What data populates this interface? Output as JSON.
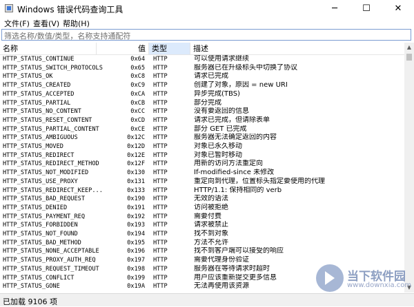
{
  "window": {
    "title": "Windows 错误代码查询工具",
    "minimize": "─",
    "maximize": "☐",
    "close": "✕"
  },
  "menu": [
    "文件(F)",
    "查看(V)",
    "帮助(H)"
  ],
  "filter": {
    "placeholder": "筛选名称/数值/类型，名称支持通配符"
  },
  "columns": {
    "name": "名称",
    "value": "值",
    "type": "类型",
    "desc": "描述",
    "sorted": "type"
  },
  "rows": [
    {
      "name": "HTTP_STATUS_CONTINUE",
      "value": "0x64",
      "type": "HTTP",
      "desc": "可以使用请求继续"
    },
    {
      "name": "HTTP_STATUS_SWITCH_PROTOCOLS",
      "value": "0x65",
      "type": "HTTP",
      "desc": "服务器已在升级标头中切换了协议"
    },
    {
      "name": "HTTP_STATUS_OK",
      "value": "0xC8",
      "type": "HTTP",
      "desc": "请求已完成"
    },
    {
      "name": "HTTP_STATUS_CREATED",
      "value": "0xC9",
      "type": "HTTP",
      "desc": "创建了对象，原因 = new URI"
    },
    {
      "name": "HTTP_STATUS_ACCEPTED",
      "value": "0xCA",
      "type": "HTTP",
      "desc": "异步完成(TBS)"
    },
    {
      "name": "HTTP_STATUS_PARTIAL",
      "value": "0xCB",
      "type": "HTTP",
      "desc": "部分完成"
    },
    {
      "name": "HTTP_STATUS_NO_CONTENT",
      "value": "0xCC",
      "type": "HTTP",
      "desc": "没有要返回的信息"
    },
    {
      "name": "HTTP_STATUS_RESET_CONTENT",
      "value": "0xCD",
      "type": "HTTP",
      "desc": "请求已完成，但请除表单"
    },
    {
      "name": "HTTP_STATUS_PARTIAL_CONTENT",
      "value": "0xCE",
      "type": "HTTP",
      "desc": "部分 GET 已完成"
    },
    {
      "name": "HTTP_STATUS_AMBIGUOUS",
      "value": "0x12C",
      "type": "HTTP",
      "desc": "服务器无法确定返回的内容"
    },
    {
      "name": "HTTP_STATUS_MOVED",
      "value": "0x12D",
      "type": "HTTP",
      "desc": "对象已永久移动"
    },
    {
      "name": "HTTP_STATUS_REDIRECT",
      "value": "0x12E",
      "type": "HTTP",
      "desc": "对象已暂时移动"
    },
    {
      "name": "HTTP_STATUS_REDIRECT_METHOD",
      "value": "0x12F",
      "type": "HTTP",
      "desc": "用新的访问方法重定向"
    },
    {
      "name": "HTTP_STATUS_NOT_MODIFIED",
      "value": "0x130",
      "type": "HTTP",
      "desc": "If-modified-since 未修改"
    },
    {
      "name": "HTTP_STATUS_USE_PROXY",
      "value": "0x131",
      "type": "HTTP",
      "desc": "重定向到代理，位置标头指定要使用的代理"
    },
    {
      "name": "HTTP_STATUS_REDIRECT_KEEP...",
      "value": "0x133",
      "type": "HTTP",
      "desc": "HTTP/1.1: 保持相同的 verb"
    },
    {
      "name": "HTTP_STATUS_BAD_REQUEST",
      "value": "0x190",
      "type": "HTTP",
      "desc": "无效的语法"
    },
    {
      "name": "HTTP_STATUS_DENIED",
      "value": "0x191",
      "type": "HTTP",
      "desc": "访问被拒绝"
    },
    {
      "name": "HTTP_STATUS_PAYMENT_REQ",
      "value": "0x192",
      "type": "HTTP",
      "desc": "需要付费"
    },
    {
      "name": "HTTP_STATUS_FORBIDDEN",
      "value": "0x193",
      "type": "HTTP",
      "desc": "请求被禁止"
    },
    {
      "name": "HTTP_STATUS_NOT_FOUND",
      "value": "0x194",
      "type": "HTTP",
      "desc": "找不到对象"
    },
    {
      "name": "HTTP_STATUS_BAD_METHOD",
      "value": "0x195",
      "type": "HTTP",
      "desc": "方法不允许"
    },
    {
      "name": "HTTP_STATUS_NONE_ACCEPTABLE",
      "value": "0x196",
      "type": "HTTP",
      "desc": "找不到客户端可以接受的响应"
    },
    {
      "name": "HTTP_STATUS_PROXY_AUTH_REQ",
      "value": "0x197",
      "type": "HTTP",
      "desc": "需要代理身份验证"
    },
    {
      "name": "HTTP_STATUS_REQUEST_TIMEOUT",
      "value": "0x198",
      "type": "HTTP",
      "desc": "服务器在等待请求时超时"
    },
    {
      "name": "HTTP_STATUS_CONFLICT",
      "value": "0x199",
      "type": "HTTP",
      "desc": "用户应该重新提交更多信息"
    },
    {
      "name": "HTTP_STATUS_GONE",
      "value": "0x19A",
      "type": "HTTP",
      "desc": "无法再使用该资源"
    }
  ],
  "status": {
    "text": "已加载 9106 项"
  },
  "watermark": {
    "text": "当下软件园",
    "url": "www.downxia.com"
  }
}
